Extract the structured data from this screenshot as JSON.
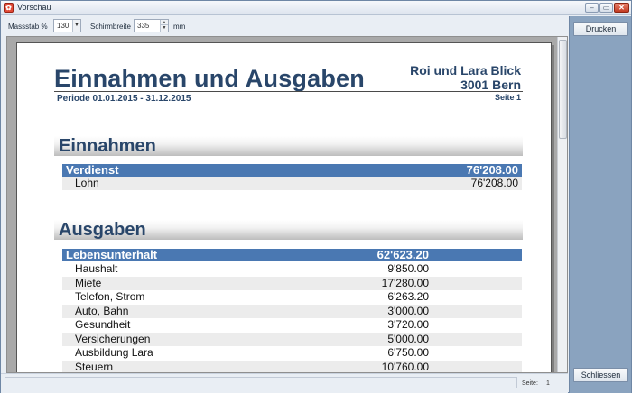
{
  "window": {
    "title": "Vorschau",
    "app_icon_glyph": "✿",
    "min_glyph": "–",
    "max_glyph": "▭",
    "close_glyph": "✕"
  },
  "toolbar": {
    "massstab_label": "Massstab %",
    "massstab_value": "130",
    "schirmbreite_label": "Schirmbreite",
    "schirmbreite_value": "335",
    "unit": "mm"
  },
  "report": {
    "title": "Einnahmen und Ausgaben",
    "period": "Periode 01.01.2015 - 31.12.2015",
    "owner": "Roi und Lara Blick",
    "city": "3001 Bern",
    "page": "Seite 1",
    "income": {
      "heading": "Einnahmen",
      "group": {
        "label": "Verdienst",
        "value": "76'208.00"
      },
      "rows": [
        {
          "label": "Lohn",
          "value": "76'208.00"
        }
      ]
    },
    "expenses": {
      "heading": "Ausgaben",
      "group": {
        "label": "Lebensunterhalt",
        "value": "62'623.20"
      },
      "rows": [
        {
          "label": "Haushalt",
          "value": "9'850.00"
        },
        {
          "label": "Miete",
          "value": "17'280.00"
        },
        {
          "label": "Telefon, Strom",
          "value": "6'263.20"
        },
        {
          "label": "Auto, Bahn",
          "value": "3'000.00"
        },
        {
          "label": "Gesundheit",
          "value": "3'720.00"
        },
        {
          "label": "Versicherungen",
          "value": "5'000.00"
        },
        {
          "label": "Ausbildung Lara",
          "value": "6'750.00"
        },
        {
          "label": "Steuern",
          "value": "10'760.00"
        }
      ]
    }
  },
  "status": {
    "seite_label": "Seite:",
    "seite_value": "1"
  },
  "side": {
    "print_label": "Drucken",
    "close_label": "Schliessen"
  },
  "colors": {
    "accent": "#4a78b2",
    "heading": "#29466a",
    "sidebar": "#8aa3bf"
  }
}
